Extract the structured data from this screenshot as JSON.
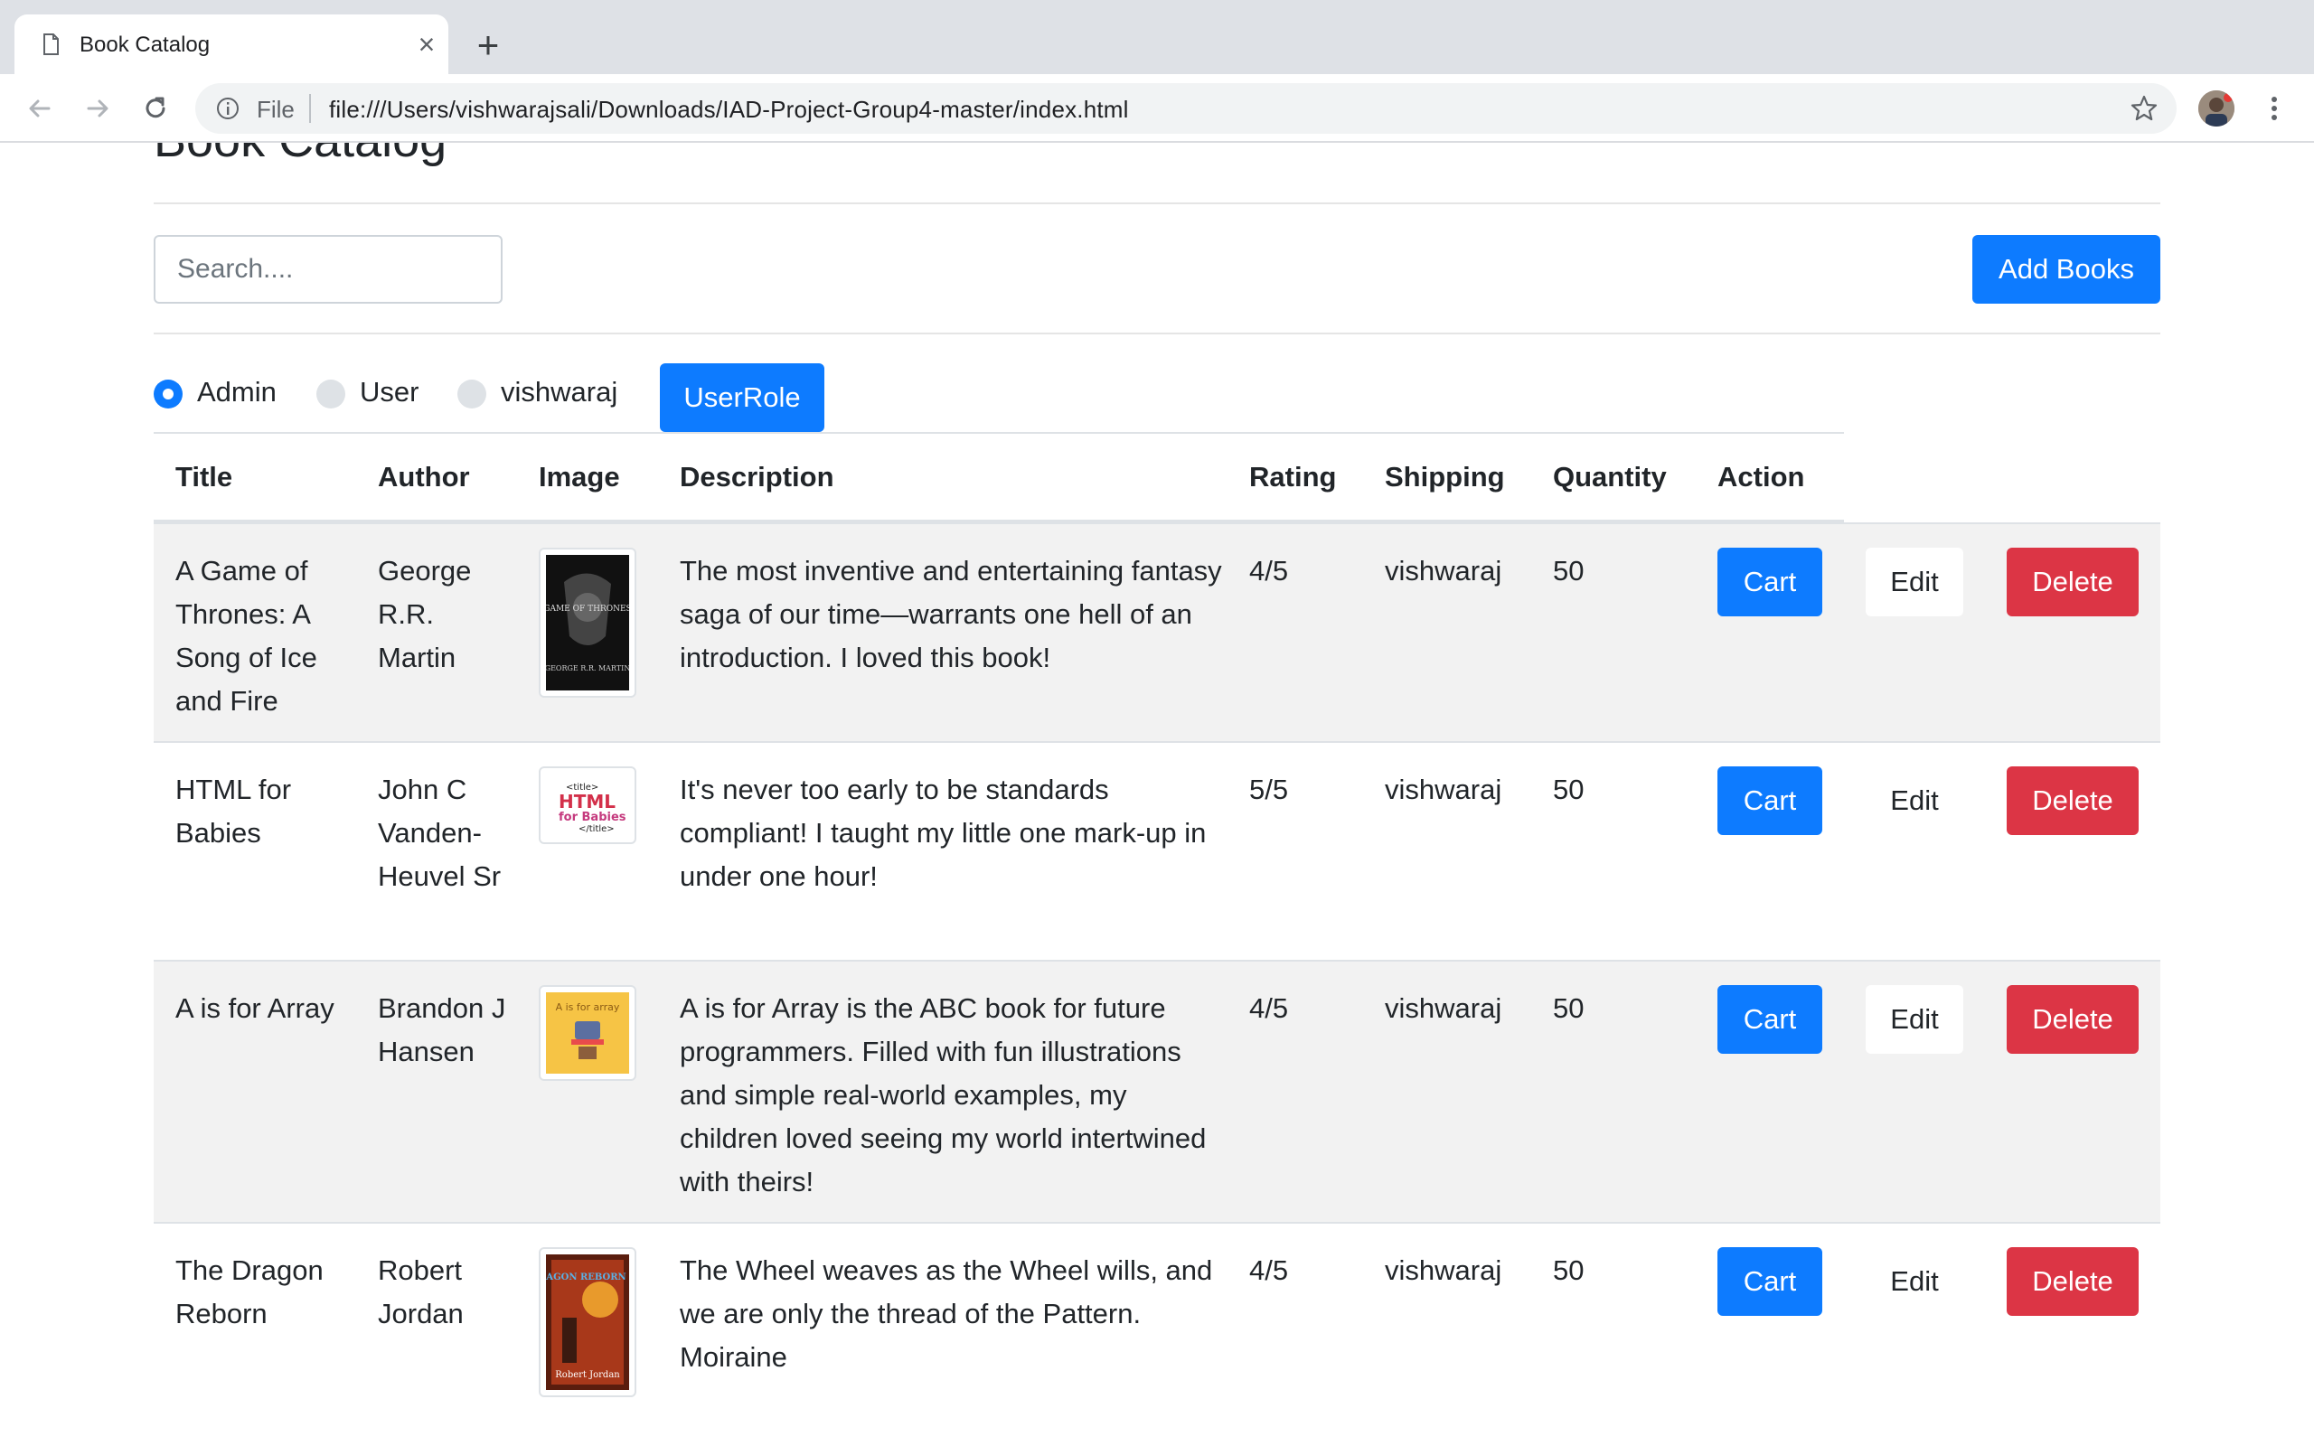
{
  "browser": {
    "tab_title": "Book Catalog",
    "new_tab": "+",
    "close": "×",
    "omnibox_scheme": "File",
    "url": "file:///Users/vishwarajsali/Downloads/IAD-Project-Group4-master/index.html"
  },
  "page": {
    "title": "Book Catalog",
    "search_placeholder": "Search....",
    "add_books_label": "Add Books",
    "roles": [
      {
        "label": "Admin",
        "checked": true
      },
      {
        "label": "User",
        "checked": false
      },
      {
        "label": "vishwaraj",
        "checked": false
      }
    ],
    "userrole_label": "UserRole"
  },
  "table": {
    "headers": [
      "Title",
      "Author",
      "Image",
      "Description",
      "Rating",
      "Shipping",
      "Quantity",
      "Action"
    ],
    "rows": [
      {
        "title": "A Game of Thrones: A Song of Ice and Fire",
        "author": "George R.R. Martin",
        "cover_text": [
          "GAME OF THRONES",
          "GEORGE R.R. MARTIN"
        ],
        "description": "The most inventive and entertaining fantasy saga of our time—warrants one hell of an introduction. I loved this book!",
        "rating": "4/5",
        "shipping": "vishwaraj",
        "quantity": "50"
      },
      {
        "title": "HTML for Babies",
        "author": "John C Vanden-Heuvel Sr",
        "cover_text": [
          "<title>",
          "HTML",
          "for Babies",
          "</title>"
        ],
        "description": "It's never too early to be standards compliant! I taught my little one mark-up in under one hour!",
        "rating": "5/5",
        "shipping": "vishwaraj",
        "quantity": "50"
      },
      {
        "title": "A is for Array",
        "author": "Brandon J Hansen",
        "cover_text": [
          "A is for array"
        ],
        "description": "A is for Array is the ABC book for future programmers. Filled with fun illustrations and simple real-world examples, my children loved seeing my world intertwined with theirs!",
        "rating": "4/5",
        "shipping": "vishwaraj",
        "quantity": "50"
      },
      {
        "title": "The Dragon Reborn",
        "author": "Robert Jordan",
        "cover_text": [
          "DRAGON REBORN",
          "Robert Jordan"
        ],
        "description": "The Wheel weaves as the Wheel wills, and we are only the thread of the Pattern. Moiraine",
        "rating": "4/5",
        "shipping": "vishwaraj",
        "quantity": "50"
      }
    ],
    "actions": {
      "cart": "Cart",
      "edit": "Edit",
      "delete": "Delete"
    }
  },
  "colors": {
    "primary": "#0d7bff",
    "danger": "#dc3545",
    "stripe": "#f2f2f2",
    "chrome_bg": "#dee1e6"
  }
}
